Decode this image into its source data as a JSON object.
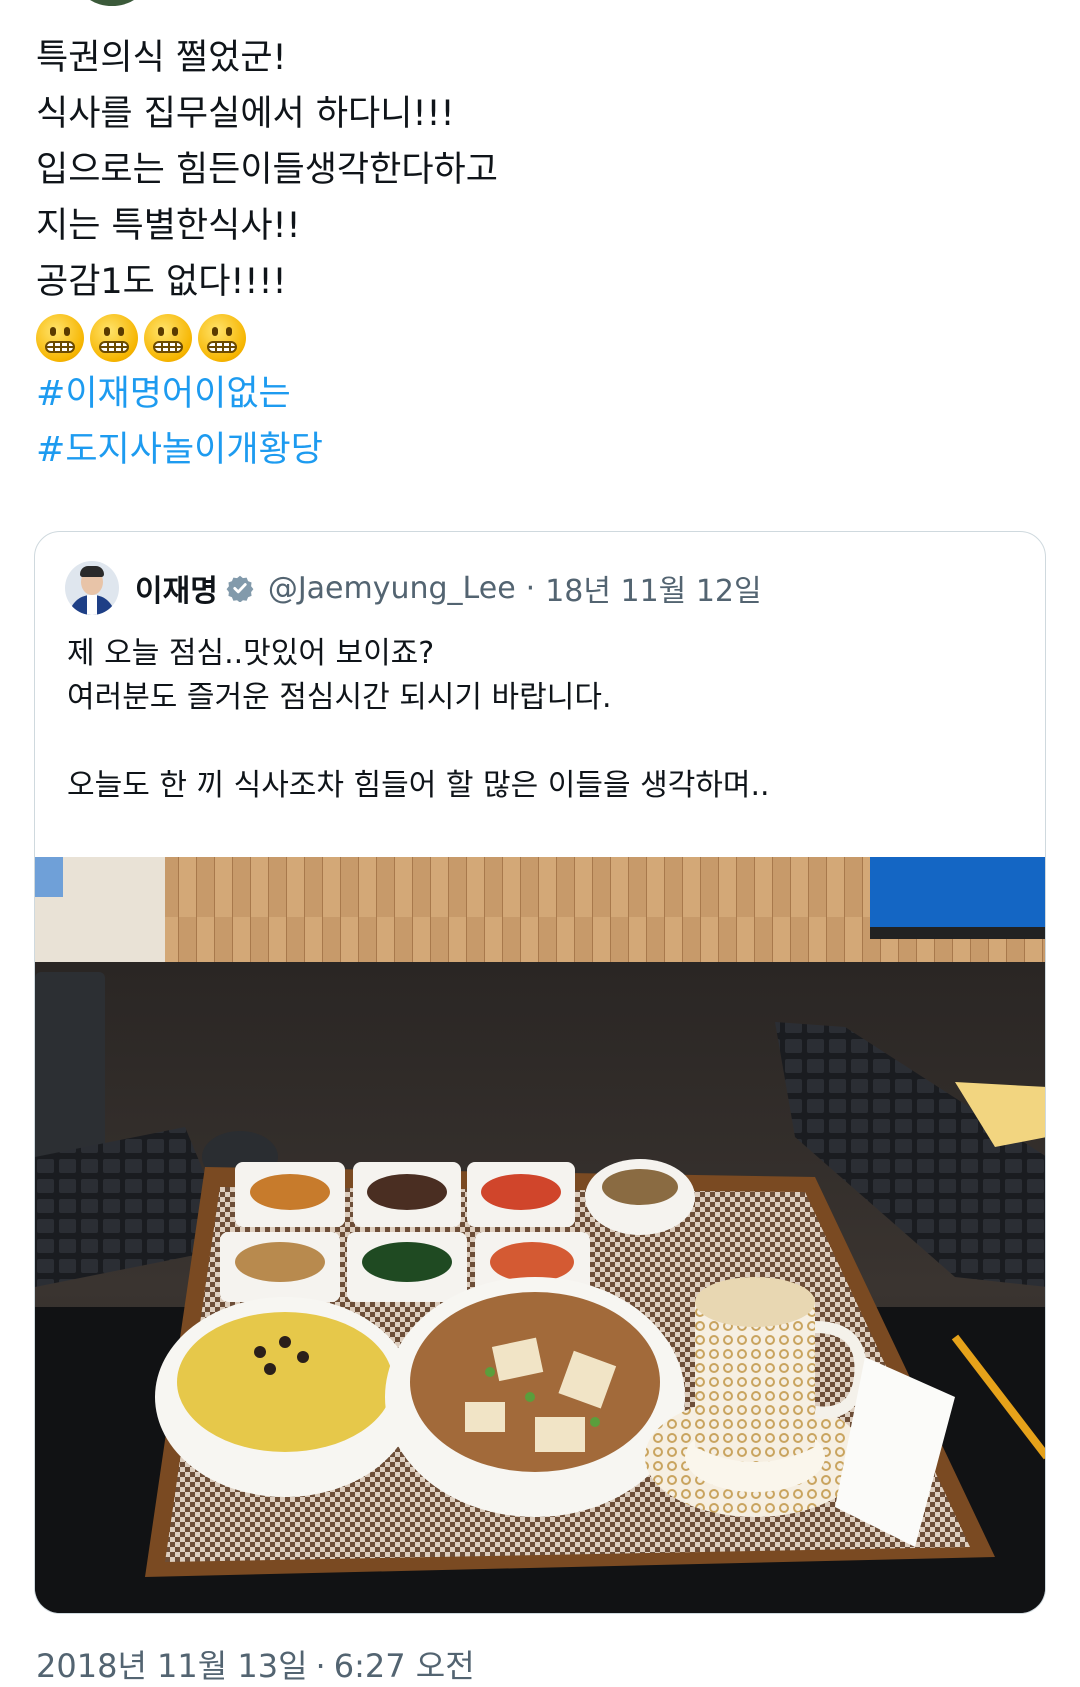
{
  "tweet": {
    "lines": [
      "특권의식 쩔었군!",
      "식사를 집무실에서 하다니!!!",
      "입으로는 힘든이들생각한다하고",
      "지는 특별한식사!!",
      "공감1도 없다!!!!"
    ],
    "emoji": [
      "grimacing-face-emoji",
      "grimacing-face-emoji",
      "grimacing-face-emoji",
      "grimacing-face-emoji"
    ],
    "hashtags": [
      "#이재명어이없는",
      "#도지사놀이개황당"
    ],
    "timestamp_date": "2018년 11월 13일",
    "timestamp_sep": "·",
    "timestamp_time": "6:27 오전"
  },
  "quote": {
    "author_name": "이재명",
    "handle": "@Jaemyung_Lee",
    "dot": "·",
    "date": "18년 11월 12일",
    "verified_icon": "verified-badge-icon",
    "lines": [
      "제 오늘 점심..맛있어 보이죠?",
      "여러분도 즐거운 점심시간 되시기 바랍니다.",
      "",
      "오늘도 한 끼 식사조차 힘들어 할 많은 이들을 생각하며.."
    ]
  },
  "colors": {
    "link": "#1d9bf0",
    "secondary_text": "#536471",
    "border": "#cfd9de",
    "verified": "#829aab"
  }
}
